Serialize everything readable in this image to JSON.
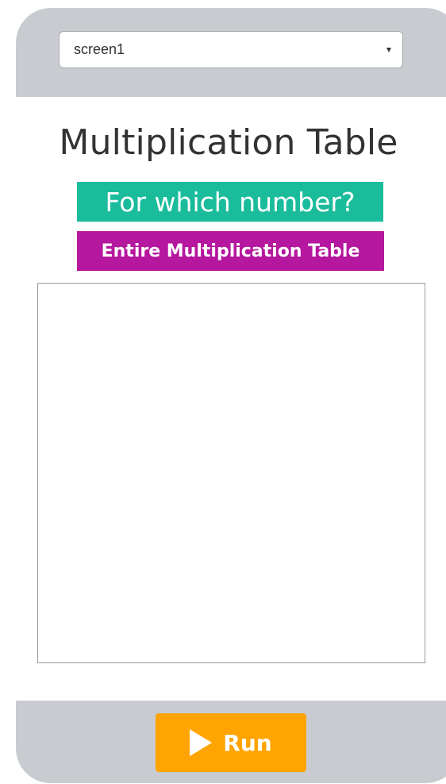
{
  "screen_select": {
    "selected": "screen1"
  },
  "app": {
    "title": "Multiplication Table",
    "number_button_label": "For which number?",
    "table_button_label": "Entire Multiplication Table",
    "output_text": ""
  },
  "run_button": {
    "label": "Run"
  },
  "colors": {
    "frame": "#c8ccd0",
    "number_button": "#1abc9c",
    "table_button": "#b5179e",
    "run_button": "#ffa400"
  },
  "icons": {
    "dropdown": "chevron-down-icon",
    "run": "play-icon"
  }
}
